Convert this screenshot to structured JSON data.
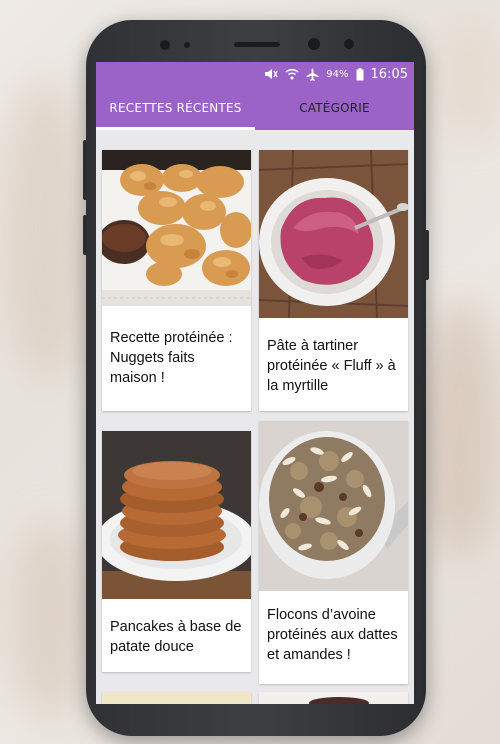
{
  "status_bar": {
    "icons": [
      "mute-icon",
      "wifi-icon",
      "airplane-icon"
    ],
    "battery": "94%",
    "time": "16:05"
  },
  "tabs": [
    {
      "label": "RECETTES RÉCENTES",
      "active": true
    },
    {
      "label": "CATÉGORIE",
      "active": false
    }
  ],
  "recipes": [
    {
      "title": "Recette protéinée : Nuggets faits maison !",
      "image": "chicken-nuggets-photo"
    },
    {
      "title": "Pâte à tartiner protéinée « Fluff » à la myrtille",
      "image": "blueberry-fluff-photo"
    },
    {
      "title": "Pancakes à base de patate douce",
      "image": "sweet-potato-pancakes-photo"
    },
    {
      "title": "Flocons d’avoine protéinés aux dattes et amandes !",
      "image": "oatmeal-dates-almonds-photo"
    }
  ],
  "colors": {
    "app_bar": "#9b63c8",
    "background": "#e9e9ec"
  }
}
